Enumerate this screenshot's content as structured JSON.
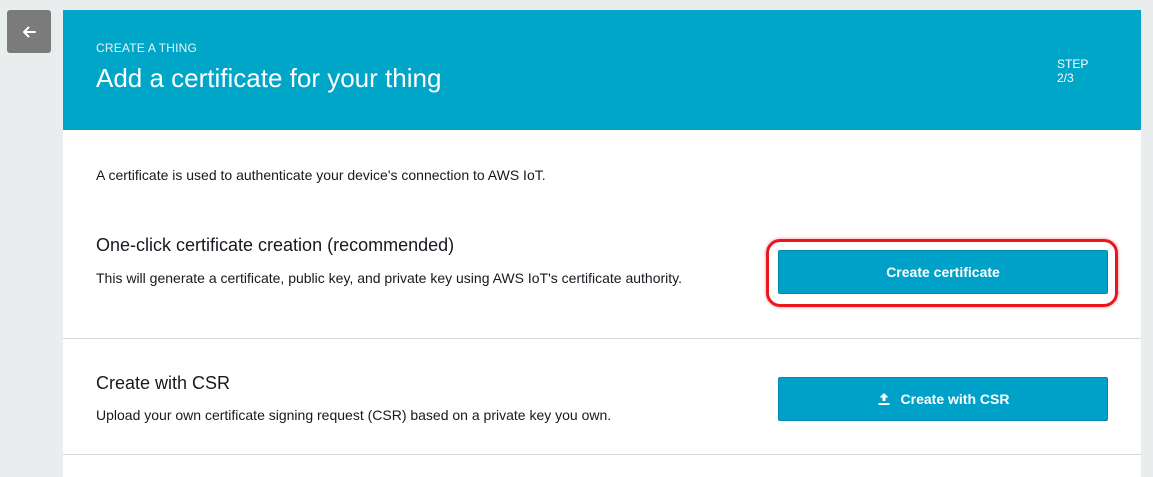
{
  "nav": {
    "back_icon": "arrow-left-icon"
  },
  "header": {
    "eyebrow": "CREATE A THING",
    "title": "Add a certificate for your thing",
    "step_label": "STEP",
    "step_value": "2/3"
  },
  "intro": "A certificate is used to authenticate your device's connection to AWS IoT.",
  "sections": [
    {
      "title": "One-click certificate creation (recommended)",
      "description": "This will generate a certificate, public key, and private key using AWS IoT's certificate authority.",
      "button_label": "Create certificate"
    },
    {
      "title": "Create with CSR",
      "description": "Upload your own certificate signing request (CSR) based on a private key you own.",
      "button_label": "Create with CSR",
      "button_icon": "upload-icon"
    }
  ],
  "colors": {
    "header_bg": "#00a6c8",
    "button_bg": "#00a1c9",
    "highlight": "#e8161d"
  }
}
